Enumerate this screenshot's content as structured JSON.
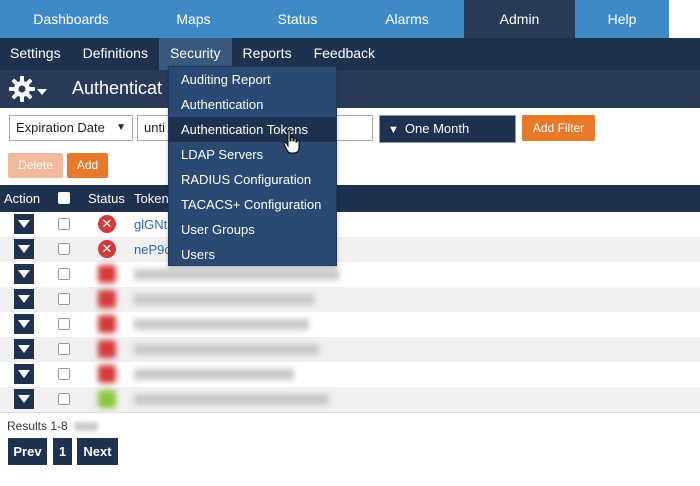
{
  "topnav": [
    "Dashboards",
    "Maps",
    "Status",
    "Alarms",
    "Admin",
    "Help"
  ],
  "subnav": [
    "Settings",
    "Definitions",
    "Security",
    "Reports",
    "Feedback"
  ],
  "title": "Authenticat",
  "filter": {
    "field": "Expiration Date",
    "operator": "unti",
    "range": "One Month",
    "add_filter": "Add Filter"
  },
  "buttons": {
    "delete": "Delete",
    "add": "Add"
  },
  "table": {
    "headers": {
      "action": "Action",
      "status": "Status",
      "token": "Token"
    },
    "rows": [
      {
        "status": "error",
        "token": "glGNt"
      },
      {
        "status": "error",
        "token": "neP9c"
      },
      {
        "status": "error",
        "token": ""
      },
      {
        "status": "error",
        "token": ""
      },
      {
        "status": "error",
        "token": ""
      },
      {
        "status": "error",
        "token": ""
      },
      {
        "status": "error",
        "token": ""
      },
      {
        "status": "ok",
        "token": ""
      }
    ]
  },
  "results": "Results 1-8",
  "pager": {
    "prev": "Prev",
    "page": "1",
    "next": "Next"
  },
  "security_menu": [
    "Auditing Report",
    "Authentication",
    "Authentication Tokens",
    "LDAP Servers",
    "RADIUS Configuration",
    "TACACS+ Configuration",
    "User Groups",
    "Users"
  ],
  "hovered_menu_item": "Authentication Tokens",
  "colors": {
    "nav": "#3e8ac7",
    "dark": "#1e3250",
    "accent": "#e77a2a",
    "error": "#d33a3a",
    "ok": "#8cc63f"
  },
  "icons": {
    "settings": "gear-icon",
    "status_error": "x-circle-icon",
    "row_action": "triangle-down-icon"
  }
}
